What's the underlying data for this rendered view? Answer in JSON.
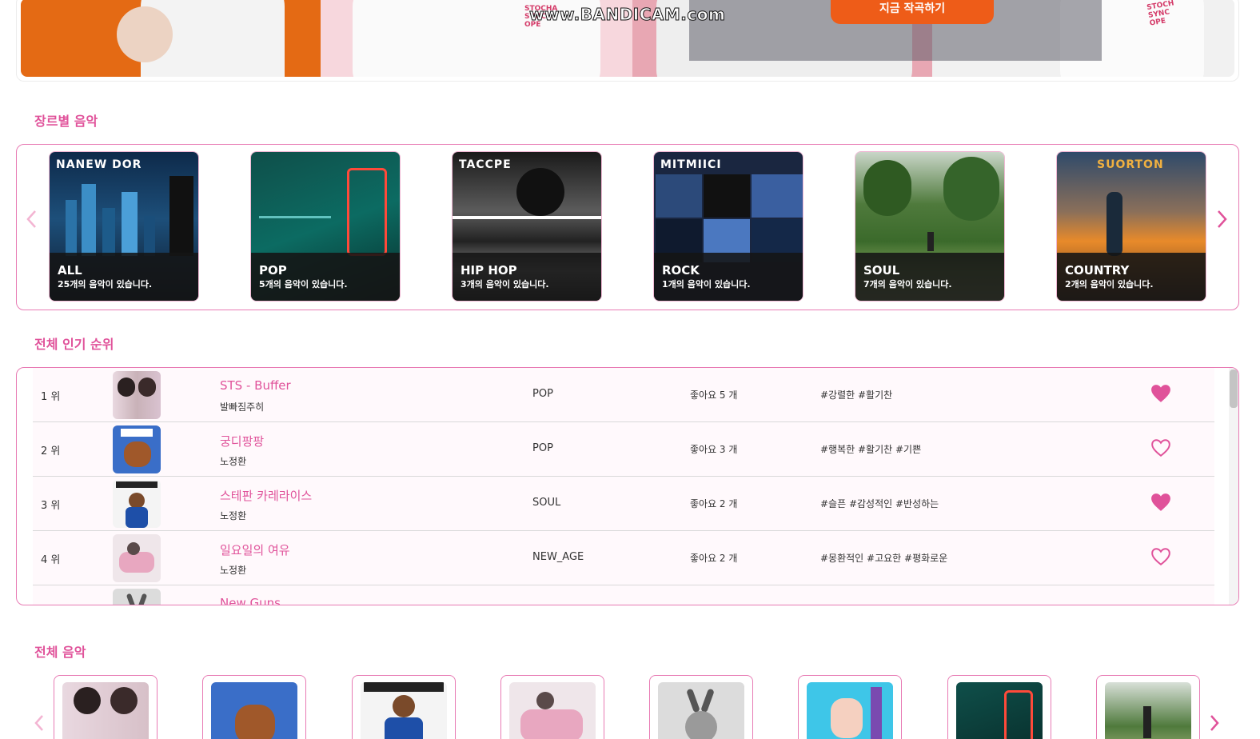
{
  "hero": {
    "cta_label": "지금 작곡하기",
    "watermark": "www.BANDICAM.com",
    "print_left": "STOCHA\nSYNCH\nOPE",
    "print_right": "STOCH\nSYNC\nOPE"
  },
  "genre_section": {
    "title": "장르별 음악",
    "cards": [
      {
        "name": "ALL",
        "count": "25개의 음악이 있습니다.",
        "art_text": "NANEW  DOR"
      },
      {
        "name": "POP",
        "count": "5개의 음악이 있습니다.",
        "art_text": ""
      },
      {
        "name": "HIP HOP",
        "count": "3개의 음악이 있습니다.",
        "art_text": "TACCPE"
      },
      {
        "name": "ROCK",
        "count": "1개의 음악이 있습니다.",
        "art_text": "MITMIICI"
      },
      {
        "name": "SOUL",
        "count": "7개의 음악이 있습니다.",
        "art_text": ""
      },
      {
        "name": "COUNTRY",
        "count": "2개의 음악이 있습니다.",
        "art_text": "SUORTON"
      }
    ]
  },
  "ranking_section": {
    "title": "전체 인기 순위",
    "rows": [
      {
        "rank": "1 위",
        "title": "STS - Buffer",
        "artist": "발빠짐주히",
        "genre": "POP",
        "likes": "좋아요 5 개",
        "tags": "#강렬한 #활기찬",
        "liked": true
      },
      {
        "rank": "2 위",
        "title": "궁디팡팡",
        "artist": "노정환",
        "genre": "POP",
        "likes": "좋아요 3 개",
        "tags": "#행복한 #활기찬 #기쁜",
        "liked": false
      },
      {
        "rank": "3 위",
        "title": "스테판 카레라이스",
        "artist": "노정환",
        "genre": "SOUL",
        "likes": "좋아요 2 개",
        "tags": "#슬픈 #감성적인 #반성하는",
        "liked": true
      },
      {
        "rank": "4 위",
        "title": "일요일의 여유",
        "artist": "노정환",
        "genre": "NEW_AGE",
        "likes": "좋아요 2 개",
        "tags": "#몽환적인 #고요한 #평화로운",
        "liked": false
      },
      {
        "rank": "",
        "title": "New Guns",
        "artist": "",
        "genre": "",
        "likes": "",
        "tags": "",
        "liked": false
      }
    ]
  },
  "all_music_section": {
    "title": "전체 음악",
    "cards": [
      "album-1",
      "album-2",
      "album-3",
      "album-4",
      "album-5",
      "album-6",
      "album-7",
      "album-8"
    ]
  },
  "colors": {
    "accent": "#e0529a",
    "border": "#e87bb4",
    "cta": "#ee5c18"
  }
}
